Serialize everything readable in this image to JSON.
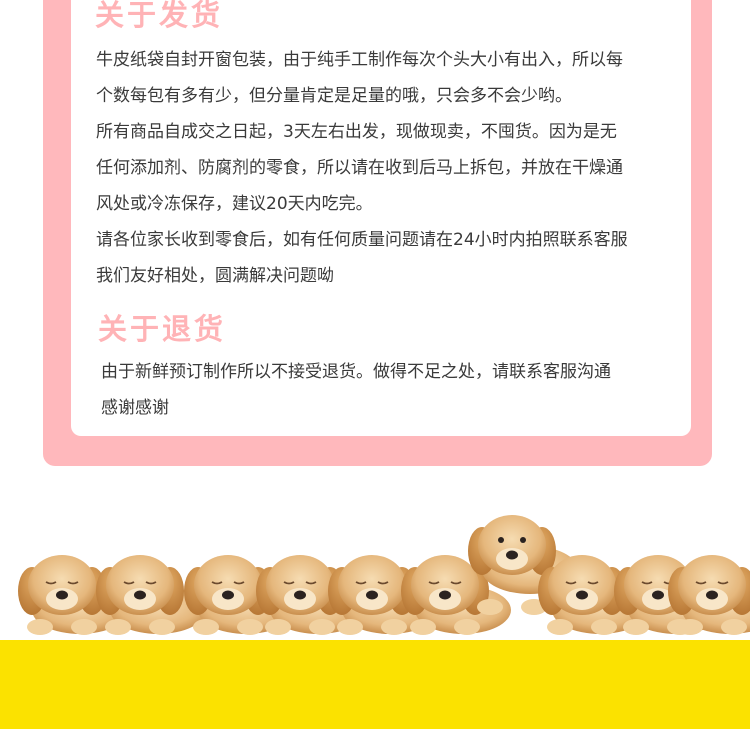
{
  "shipping": {
    "title": "关于发货",
    "paragraphs": [
      [
        "牛皮纸袋自封开窗包装，由于纯手工制作每次个头大小有出入，所以每",
        "个数每包有多有少，但分量肯定是足量的哦，只会多不会少哟。"
      ],
      [
        "所有商品自成交之日起，3天左右出发，现做现卖，不囤货。因为是无",
        "任何添加剂、防腐剂的零食，所以请在收到后马上拆包，并放在干燥通",
        "风处或冷冻保存，建议20天内吃完。"
      ],
      [
        "请各位家长收到零食后，如有任何质量问题请在24小时内拍照联系客服",
        "我们友好相处，圆满解决问题呦"
      ]
    ]
  },
  "returns": {
    "title": "关于退货",
    "paragraphs": [
      [
        "由于新鲜预订制作所以不接受退货。做得不足之处，请联系客服沟通",
        "感谢感谢"
      ]
    ]
  },
  "colors": {
    "frame_pink": "#ffb8bc",
    "title_pink": "#ffb3b6",
    "text": "#3a3a3a",
    "footer_yellow": "#fbe200"
  },
  "illustration": {
    "subject": "puppy-row",
    "count": 10
  }
}
